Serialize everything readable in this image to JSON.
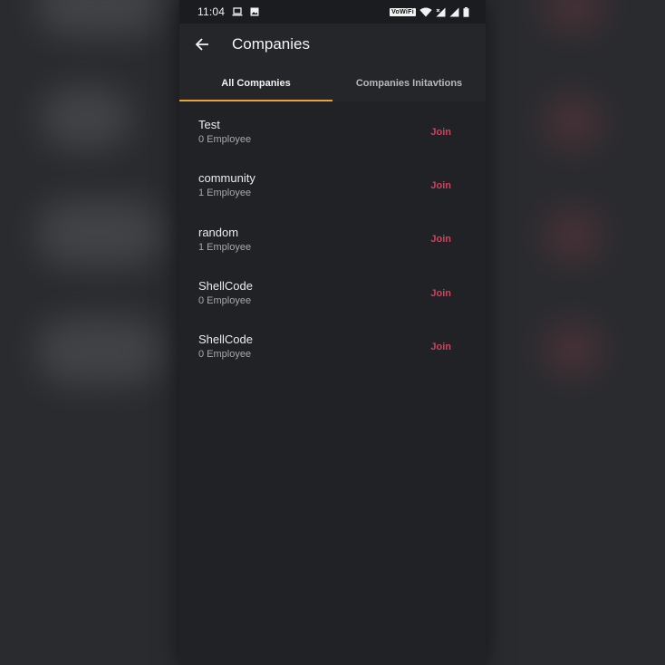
{
  "status_bar": {
    "time": "11:04",
    "vowifi": "VoWiFi",
    "icons": [
      "laptop-icon",
      "image-icon",
      "wifi-icon",
      "signal-icon",
      "battery-icon"
    ]
  },
  "app_bar": {
    "title": "Companies",
    "back_icon": "arrow-left-icon"
  },
  "tabs": [
    {
      "label": "All Companies",
      "active": true
    },
    {
      "label": "Companies Initavtions",
      "active": false
    }
  ],
  "companies": [
    {
      "name": "Test",
      "employees": "0 Employee",
      "action": "Join"
    },
    {
      "name": "community",
      "employees": "1 Employee",
      "action": "Join"
    },
    {
      "name": "random",
      "employees": "1 Employee",
      "action": "Join"
    },
    {
      "name": "ShellCode",
      "employees": "0 Employee",
      "action": "Join"
    },
    {
      "name": "ShellCode",
      "employees": "0 Employee",
      "action": "Join"
    }
  ],
  "colors": {
    "accent_tab": "#e8a33c",
    "join": "#c9465d",
    "background": "#212226"
  }
}
